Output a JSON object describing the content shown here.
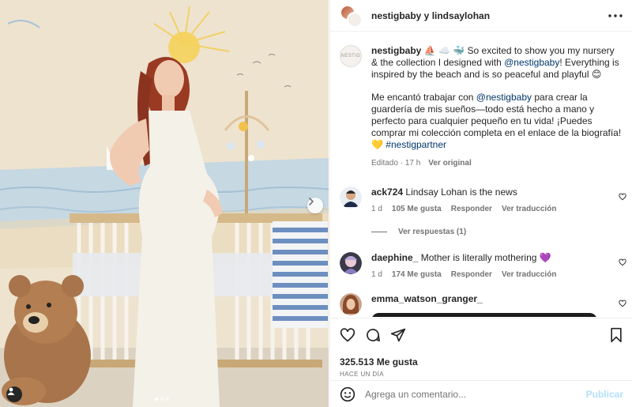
{
  "post": {
    "header_users": "nestigbaby y lindsaylohan",
    "more_icon": "more-horizontal-icon"
  },
  "caption": {
    "username": "nestigbaby",
    "emojis": "⛵ ☁️ 🐳",
    "text_1a": "So excited to show you my nursery & the collection I designed with",
    "mention_1": "@nestigbaby",
    "text_1b": "! Everything is inspired by the beach and is so peaceful and playful 😊",
    "text_2a": "Me encantó trabajar con",
    "mention_2": "@nestigbaby",
    "text_2b": "para crear la guardería de mis sueños—todo está hecho a mano y perfecto para cualquier pequeño en tu vida! ¡Puedes comprar mi colección completa en el enlace de la biografía! 💛",
    "hashtag": "#nestigpartner",
    "edited": "Editado",
    "age": "17 h",
    "see_original": "Ver original"
  },
  "brand_avatar_text": "NESTIG",
  "comments": [
    {
      "username": "ack724",
      "text": "Lindsay Lohan is the news",
      "age": "1 d",
      "likes": "105 Me gusta",
      "reply": "Responder",
      "translate": "Ver traducción",
      "view_replies": "Ver respuestas (1)"
    },
    {
      "username": "daephine_",
      "text": "Mother is literally mothering 💜",
      "age": "1 d",
      "likes": "174 Me gusta",
      "reply": "Responder",
      "translate": "Ver traducción"
    },
    {
      "username": "emma_watson_granger_",
      "text": ""
    }
  ],
  "actions": {
    "like_icon": "heart-icon",
    "comment_icon": "comment-icon",
    "share_icon": "share-icon",
    "save_icon": "bookmark-icon",
    "likes_count": "325.513 Me gusta",
    "posted_when": "HACE UN DÍA"
  },
  "add_comment": {
    "placeholder": "Agrega un comentario...",
    "publish": "Publicar",
    "emoji_icon": "emoji-icon"
  },
  "carousel": {
    "slides": 3,
    "active_slide": 1
  },
  "colors": {
    "link": "#00376b",
    "muted": "#737373",
    "publish_disabled": "#b2dffc"
  }
}
